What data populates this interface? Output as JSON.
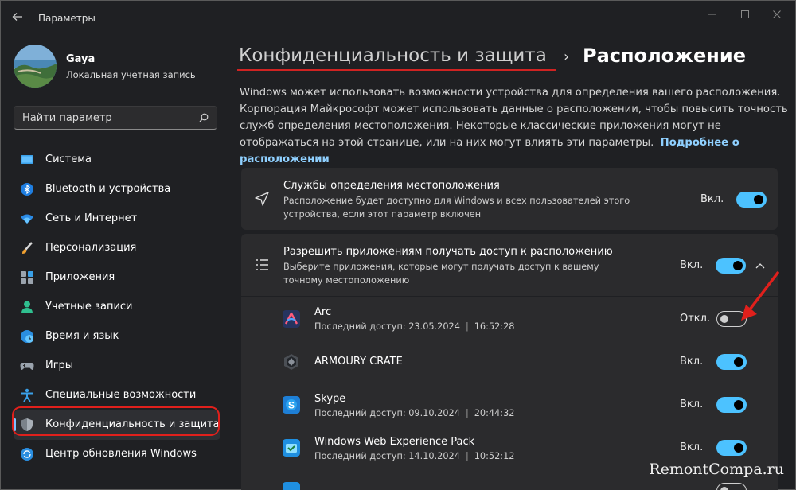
{
  "window": {
    "title": "Параметры"
  },
  "profile": {
    "name": "Gaya",
    "account_type": "Локальная учетная запись"
  },
  "search": {
    "placeholder": "Найти параметр"
  },
  "nav": [
    {
      "label": "Система",
      "icon": "monitor-icon"
    },
    {
      "label": "Bluetooth и устройства",
      "icon": "bluetooth-icon"
    },
    {
      "label": "Сеть и Интернет",
      "icon": "wifi-icon"
    },
    {
      "label": "Персонализация",
      "icon": "brush-icon"
    },
    {
      "label": "Приложения",
      "icon": "apps-icon"
    },
    {
      "label": "Учетные записи",
      "icon": "person-icon"
    },
    {
      "label": "Время и язык",
      "icon": "globe-clock-icon"
    },
    {
      "label": "Игры",
      "icon": "gamepad-icon"
    },
    {
      "label": "Специальные возможности",
      "icon": "accessibility-icon"
    },
    {
      "label": "Конфиденциальность и защита",
      "icon": "shield-icon",
      "active": true
    },
    {
      "label": "Центр обновления Windows",
      "icon": "update-icon"
    }
  ],
  "breadcrumb": {
    "parent": "Конфиденциальность и защита",
    "separator": "›",
    "current": "Расположение"
  },
  "description": {
    "text": "Windows может использовать возможности устройства для определения вашего расположения. Корпорация Майкрософт может использовать данные о расположении, чтобы повысить точность служб определения местоположения. Некоторые классические приложения могут не отображаться на этой странице, или на них могут влиять эти параметры.",
    "link": "Подробнее о расположении"
  },
  "location_services": {
    "title": "Службы определения местоположения",
    "subtitle": "Расположение будет доступно для Windows и всех пользователей этого устройства, если этот параметр включен",
    "state": "Вкл.",
    "on": true
  },
  "app_access": {
    "title": "Разрешить приложениям получать доступ к расположению",
    "subtitle": "Выберите приложения, которые могут получать доступ к вашему точному местоположению",
    "state": "Вкл.",
    "on": true,
    "expanded": true
  },
  "apps": [
    {
      "name": "Arc",
      "meta_label": "Последний доступ:",
      "date": "23.05.2024",
      "time": "16:52:28",
      "state": "Откл.",
      "on": false
    },
    {
      "name": "ARMOURY CRATE",
      "state": "Вкл.",
      "on": true
    },
    {
      "name": "Skype",
      "meta_label": "Последний доступ:",
      "date": "09.10.2024",
      "time": "20:44:32",
      "state": "Вкл.",
      "on": true
    },
    {
      "name": "Windows Web Experience Pack",
      "meta_label": "Последний доступ:",
      "date": "14.10.2024",
      "time": "10:52:12",
      "state": "Вкл.",
      "on": true
    }
  ],
  "watermark": "RemontCompa.ru",
  "colors": {
    "accent": "#4cc2ff",
    "highlight_red": "#e0201c",
    "background": "#1f2023",
    "card": "#2b2b2d"
  }
}
